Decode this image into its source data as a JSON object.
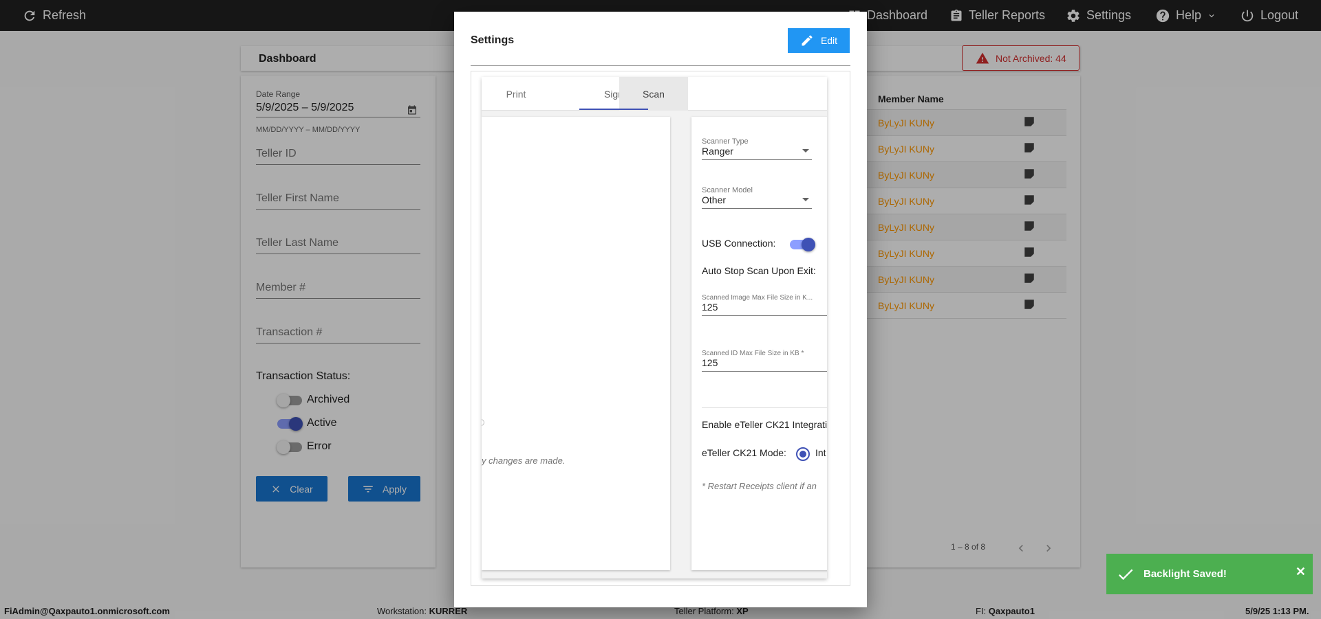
{
  "topbar": {
    "refresh_label": "Refresh",
    "dashboard_label": "Dashboard",
    "teller_reports_label": "Teller Reports",
    "settings_label": "Settings",
    "help_label": "Help",
    "logout_label": "Logout"
  },
  "page": {
    "title": "Dashboard",
    "not_archived_badge": "Not Archived: 44"
  },
  "filters": {
    "date_range_label": "Date Range",
    "date_range_value": "5/9/2025 – 5/9/2025",
    "date_range_hint": "MM/DD/YYYY – MM/DD/YYYY",
    "teller_id": "Teller ID",
    "teller_first_name": "Teller First Name",
    "teller_last_name": "Teller Last Name",
    "member_number": "Member #",
    "transaction_number": "Transaction #",
    "status_label": "Transaction Status:",
    "statuses": [
      {
        "label": "Archived",
        "on": false
      },
      {
        "label": "Active",
        "on": true
      },
      {
        "label": "Error",
        "on": false
      }
    ],
    "clear_label": "Clear",
    "apply_label": "Apply"
  },
  "table": {
    "member_name_header": "Member Name",
    "rows": [
      {
        "member_name": "ByLyJI KUNy"
      },
      {
        "member_name": "ByLyJI KUNy"
      },
      {
        "member_name": "ByLyJI KUNy"
      },
      {
        "member_name": "ByLyJI KUNy"
      },
      {
        "member_name": "ByLyJI KUNy"
      },
      {
        "member_name": "ByLyJI KUNy"
      },
      {
        "member_name": "ByLyJI KUNy"
      },
      {
        "member_name": "ByLyJI KUNy"
      }
    ],
    "paginator": "1 – 8 of 8"
  },
  "modal": {
    "title": "Settings",
    "edit_label": "Edit",
    "tabs": [
      "Print",
      "Sign",
      "Scan"
    ],
    "active_tab": "Scan",
    "left_card_text": "y changes are made.",
    "scanner_type_label": "Scanner Type",
    "scanner_type_value": "Ranger",
    "scanner_model_label": "Scanner Model",
    "scanner_model_value": "Other",
    "usb_connection_label": "USB Connection:",
    "usb_connection_on": true,
    "auto_stop_label": "Auto Stop Scan Upon Exit:",
    "image_max_size_label": "Scanned Image Max File Size in K...",
    "image_max_size_value": "125",
    "id_max_size_label": "Scanned ID Max File Size in KB *",
    "id_max_size_value": "125",
    "enable_ck21_label": "Enable eTeller CK21 Integrati",
    "ck21_mode_label": "eTeller CK21 Mode:",
    "ck21_mode_option": "Int",
    "restart_note": "* Restart Receipts client if an"
  },
  "statusbar": {
    "user": "FiAdmin@Qaxpauto1.onmicrosoft.com",
    "workstation_label": "Workstation:",
    "workstation_value": "KURRER",
    "platform_label": "Teller Platform:",
    "platform_value": "XP",
    "fi_label": "FI:",
    "fi_value": "Qaxpauto1",
    "datetime": "5/9/25 1:13 PM."
  },
  "toast": {
    "message": "Backlight Saved!"
  }
}
